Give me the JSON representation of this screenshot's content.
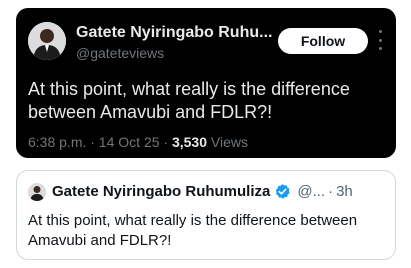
{
  "main_post": {
    "author_name": "Gatete Nyiringabo Ruhu...",
    "handle": "@gateteviews",
    "follow_label": "Follow",
    "text": "At this point, what really is the difference between Amavubi and FDLR?!",
    "timestamp": "6:38 p.m. · 14 Oct 25 · ",
    "views_count": "3,530",
    "views_label": " Views",
    "more_icon": "more-vertical-icon"
  },
  "quoted_post": {
    "author_name": "Gatete Nyiringabo Ruhumuliza",
    "handle": "@...",
    "separator": "·",
    "time": "3h",
    "text": "At this point, what really is the difference between Amavubi and FDLR?!",
    "verified_icon": "verified-badge-icon"
  },
  "colors": {
    "dark_bg": "#000000",
    "verified_blue": "#1d9bf0",
    "muted_text": "#71767b"
  }
}
